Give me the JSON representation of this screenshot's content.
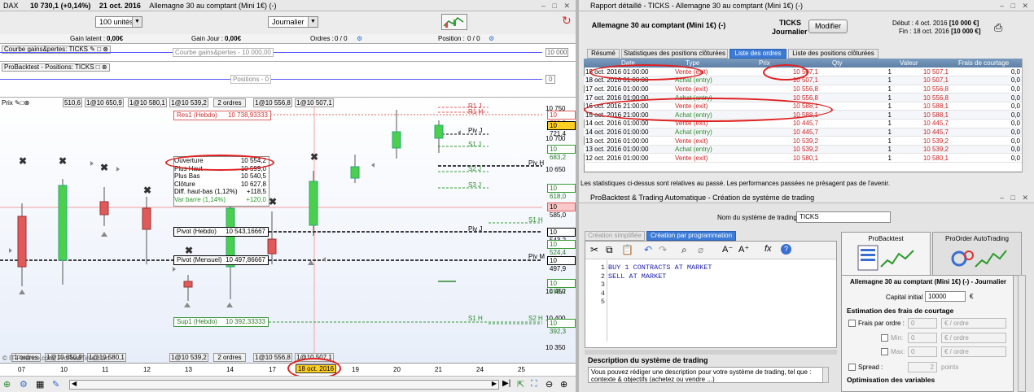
{
  "left": {
    "title": "DAX",
    "title_price": "10 730,1 (+0,14%)",
    "title_date": "21 oct. 2016",
    "title_desc": "Allemagne 30 au comptant (Mini 1€) (-)",
    "units_select": "100 unités",
    "period_select": "Journalier",
    "stats": {
      "gain_latent_label": "Gain latent :",
      "gain_latent_value": "0,00€",
      "gain_jour_label": "Gain Jour :",
      "gain_jour_value": "0,00€",
      "ordres_label": "Ordres :",
      "ordres_value": "0 / 0",
      "position_label": "Position :",
      "position_value": "0 / 0"
    },
    "courbe_label": "Courbe gains&pertes: TICKS",
    "courbe_center": "Courbe gains&pertes - 10 000,00",
    "courbe_value": "10 000",
    "positions_label": "ProBacktest - Positions: TICKS",
    "positions_center": "Positions - 0",
    "positions_value": "0",
    "prix_label": "Prix",
    "order_tags_top": [
      "510,6",
      "1@10 650,9",
      "1@10 580,1",
      "1@10 539,2",
      "2 ordres",
      "1@10 556,8",
      "1@10 507,1"
    ],
    "order_tags_bottom": [
      "1 ordres",
      "1@10 650,9",
      "1@10 580,1",
      "1@10 539,2",
      "2 ordres",
      "1@10 556,8",
      "1@10 507,1"
    ],
    "copyright": "© IT-Finance.com, ProRealTime.com",
    "tooltip": {
      "rows": [
        [
          "Ouverture",
          "10 554,2"
        ],
        [
          "Plus Haut",
          "10 599,0"
        ],
        [
          "Plus Bas",
          "10 540,5"
        ],
        [
          "Clôture",
          "10 627,8"
        ],
        [
          "Diff. haut-bas (1,12%)",
          "+118,5"
        ],
        [
          "Var barre (1,14%)",
          "+120,0"
        ]
      ]
    },
    "levels": {
      "res1": "Res1 (Hebdo)",
      "res1_val": "10 738,93333",
      "pivot_hebdo": "Pivot (Hebdo)",
      "pivot_hebdo_val": "10 543,16667",
      "pivot_mensuel": "Pivot (Mensuel)",
      "pivot_mensuel_val": "10 497,86667",
      "sup1": "Sup1 (Hebdo)",
      "sup1_val": "10 392,33333"
    },
    "line_tags": [
      "R1 J",
      "R1 H",
      "Piv J",
      "S1 J",
      "S2 J",
      "Piv H",
      "S3 J",
      "S1 H",
      "Piv M",
      "S1 H",
      "S2 H"
    ],
    "price_axis": [
      "10 750",
      "10 700",
      "10 650",
      "10 450",
      "10 400",
      "10 350"
    ],
    "price_boxes": [
      "10 738,9",
      "10 721,4",
      "10 683,2",
      "10 618,0",
      "10 585,0",
      "10 543,2",
      "10 524,4",
      "10 497,9",
      "10 459,2",
      "10 392,3"
    ],
    "dates": [
      "07",
      "10",
      "11",
      "12",
      "13",
      "14",
      "17",
      "18 oct. 2016",
      "19",
      "20",
      "21",
      "24",
      "25"
    ]
  },
  "right": {
    "title": "Rapport détaillé - TICKS - Allemagne 30 au comptant (Mini 1€) (-)",
    "header_name": "Allemagne 30 au comptant (Mini 1€) (-)",
    "header_ticks": "TICKS",
    "header_journalier": "Journalier",
    "modifier_btn": "Modifier",
    "debut_label": "Début :",
    "debut_value": "4 oct. 2016",
    "debut_amount": "[10 000 €]",
    "fin_label": "Fin :",
    "fin_value": "18 oct. 2016",
    "fin_amount": "[10 000 €]",
    "tabs": [
      "Résumé",
      "Statistiques des positions clôturées",
      "Liste des ordres",
      "Liste des positions clôturées"
    ],
    "columns": [
      "Date",
      "Type",
      "Prix",
      "Qty",
      "Valeur",
      "Frais de courtage"
    ],
    "orders": [
      [
        "18 oct. 2016 01:00:00",
        "Vente (exit)",
        "10 507,1",
        "1",
        "10 507,1",
        "0,0"
      ],
      [
        "18 oct. 2016 01:00:00",
        "Achat (entry)",
        "10 507,1",
        "1",
        "10 507,1",
        "0,0"
      ],
      [
        "17 oct. 2016 01:00:00",
        "Vente (exit)",
        "10 556,8",
        "1",
        "10 556,8",
        "0,0"
      ],
      [
        "17 oct. 2016 01:00:00",
        "Achat (entry)",
        "10 556,8",
        "1",
        "10 556,8",
        "0,0"
      ],
      [
        "16 oct. 2016 21:00:00",
        "Vente (exit)",
        "10 588,1",
        "1",
        "10 588,1",
        "0,0"
      ],
      [
        "15 oct. 2016 21:00:00",
        "Achat (entry)",
        "10 588,1",
        "1",
        "10 588,1",
        "0,0"
      ],
      [
        "14 oct. 2016 01:00:00",
        "Vente (exit)",
        "10 445,7",
        "1",
        "10 445,7",
        "0,0"
      ],
      [
        "14 oct. 2016 01:00:00",
        "Achat (entry)",
        "10 445,7",
        "1",
        "10 445,7",
        "0,0"
      ],
      [
        "13 oct. 2016 01:00:00",
        "Vente (exit)",
        "10 539,2",
        "1",
        "10 539,2",
        "0,0"
      ],
      [
        "13 oct. 2016 01:00:00",
        "Achat (entry)",
        "10 539,2",
        "1",
        "10 539,2",
        "0,0"
      ],
      [
        "12 oct. 2016 01:00:00",
        "Vente (exit)",
        "10 580,1",
        "1",
        "10 580,1",
        "0,0"
      ]
    ],
    "disclaimer": "Les statistiques ci-dessus sont relatives au passé. Les performances passées ne présagent pas de l'avenir."
  },
  "creator": {
    "title": "ProBacktest & Trading Automatique - Création de système de trading",
    "name_label": "Nom du système de trading",
    "name_value": "TICKS",
    "tab_simple": "Création simplifiée",
    "tab_prog": "Création par programmation",
    "code_lines": [
      "",
      "BUY 1 CONTRACTS AT MARKET",
      "SELL AT MARKET",
      "",
      ""
    ],
    "line_numbers": [
      "1",
      "2",
      "3",
      "4",
      "5"
    ],
    "desc_title": "Description du système de trading",
    "desc_text": "Vous pouvez rédiger une description pour votre système de trading, tel que : contexte & objectifs (achetez ou vendre ...)",
    "probacktest_tab": "ProBacktest",
    "proorder_tab": "ProOrder AutoTrading",
    "instrument": "Allemagne 30 au comptant (Mini 1€) (-) - Journalier",
    "capital_label": "Capital initial :",
    "capital_value": "10000",
    "capital_unit": "€",
    "frais_title": "Estimation des frais de courtage",
    "frais_par_ordre": "Frais par ordre :",
    "min_label": "Min:",
    "max_label": "Max:",
    "zero": "0",
    "per_order": "€ / ordre",
    "spread_label": "Spread :",
    "spread_value": "2",
    "points": "points",
    "optim_title": "Optimisation des variables"
  }
}
